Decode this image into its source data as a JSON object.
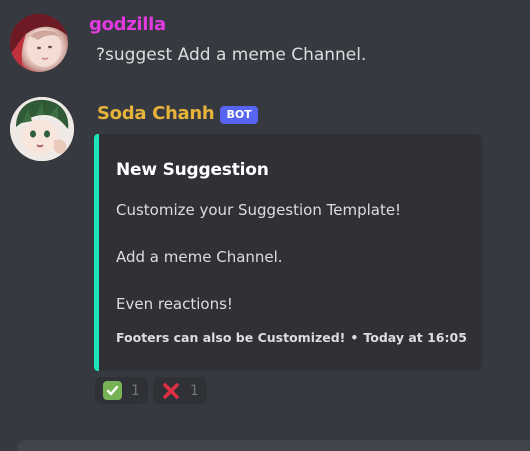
{
  "messages": [
    {
      "author": "godzilla",
      "author_color": "#e13be0",
      "text": "?suggest Add a meme Channel."
    },
    {
      "author": "Soda Chanh",
      "author_color": "#e6b33a",
      "tag": "BOT",
      "embed": {
        "accent_color": "#1ce6b9",
        "title": "New Suggestion",
        "lines": [
          "Customize your Suggestion Template!",
          "Add a meme Channel.",
          "Even reactions!"
        ],
        "footer_text": "Footers can also be Customized!",
        "footer_separator": "•",
        "footer_timestamp": "Today at 16:05"
      },
      "reactions": [
        {
          "icon": "check-mark-icon",
          "count": "1"
        },
        {
          "icon": "cross-mark-icon",
          "count": "1"
        }
      ]
    }
  ]
}
